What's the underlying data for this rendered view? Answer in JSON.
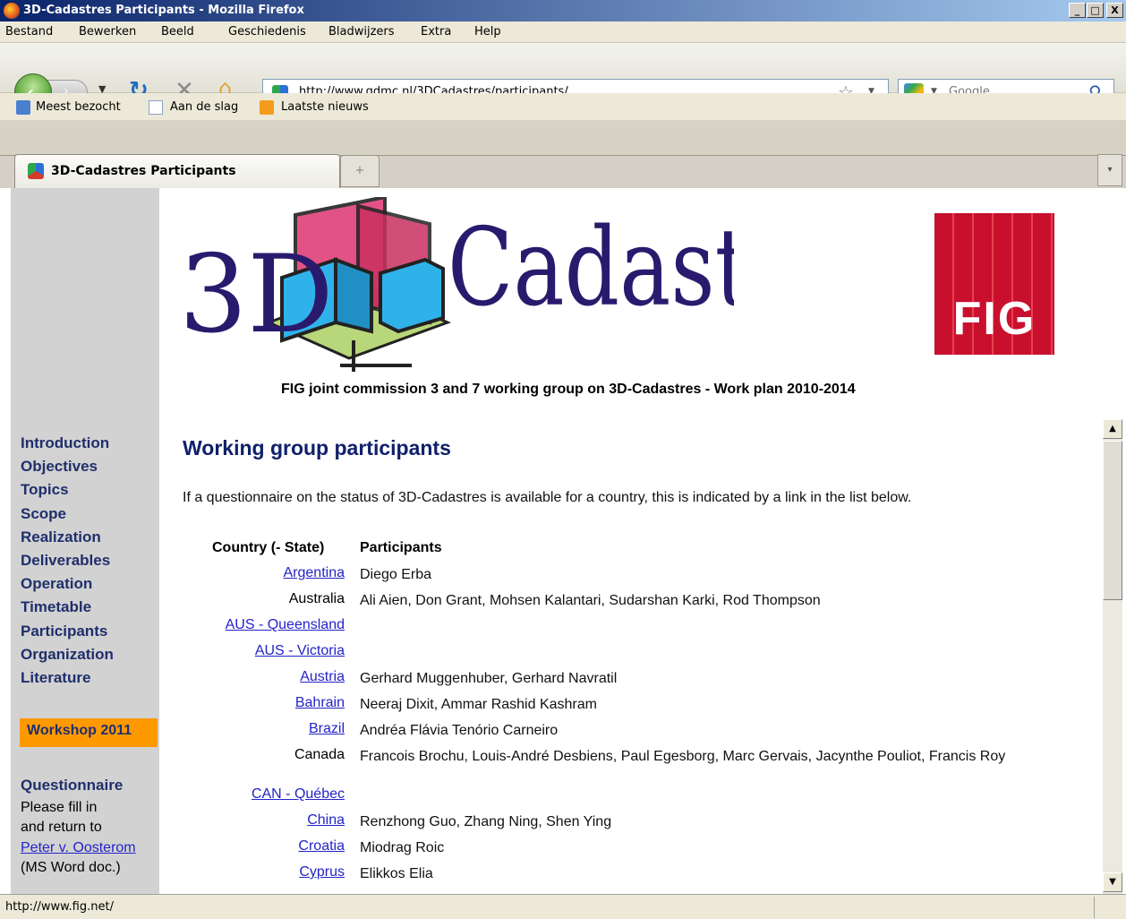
{
  "window": {
    "title": "3D-Cadastres Participants - Mozilla Firefox",
    "minimize": "_",
    "maximize": "□",
    "close": "X"
  },
  "menu": [
    "Bestand",
    "Bewerken",
    "Beeld",
    "Geschiedenis",
    "Bladwijzers",
    "Extra",
    "Help"
  ],
  "nav": {
    "url": "http://www.gdmc.nl/3DCadastres/participants/",
    "search_placeholder": "Google"
  },
  "bookmarks": [
    "Meest bezocht",
    "Aan de slag",
    "Laatste nieuws"
  ],
  "tab": {
    "label": "3D-Cadastres Participants",
    "new_tab": "+",
    "list": "▾"
  },
  "page": {
    "logo_text": "Cadastres",
    "logo_prefix": "3D",
    "fig_logo": "FIG",
    "subtitle": "FIG joint commission 3 and 7 working group on 3D-Cadastres - Work plan 2010-2014",
    "heading": "Working group participants",
    "intro": "If a questionnaire on the status of 3D-Cadastres is available for a country, this is indicated by a link in the list below.",
    "col_country": "Country (- State)",
    "col_participants": "Participants",
    "rows": [
      {
        "country": "Argentina",
        "link": true,
        "participants": "Diego Erba"
      },
      {
        "country": "Australia",
        "link": false,
        "participants": "Ali Aien, Don Grant, Mohsen Kalantari, Sudarshan Karki, Rod Thompson"
      },
      {
        "country": "AUS - Queensland",
        "link": true,
        "participants": ""
      },
      {
        "country": "AUS - Victoria",
        "link": true,
        "participants": ""
      },
      {
        "country": "Austria",
        "link": true,
        "participants": "Gerhard Muggenhuber, Gerhard Navratil"
      },
      {
        "country": "Bahrain",
        "link": true,
        "participants": "Neeraj Dixit, Ammar Rashid Kashram"
      },
      {
        "country": "Brazil",
        "link": true,
        "participants": "Andréa Flávia Tenório Carneiro"
      },
      {
        "country": "Canada",
        "link": false,
        "participants": "Francois Brochu, Louis-André Desbiens, Paul Egesborg, Marc Gervais, Jacynthe Pouliot, Francis Roy"
      },
      {
        "country": "CAN - Québec",
        "link": true,
        "participants": ""
      },
      {
        "country": "China",
        "link": true,
        "participants": "Renzhong Guo, Zhang Ning, Shen Ying"
      },
      {
        "country": "Croatia",
        "link": true,
        "participants": "Miodrag Roic"
      },
      {
        "country": "Cyprus",
        "link": true,
        "participants": "Elikkos Elia"
      }
    ]
  },
  "sidebar": {
    "links": [
      "Introduction",
      "Objectives",
      "Topics",
      "Scope",
      "Realization",
      "Deliverables",
      "Operation",
      "Timetable",
      "Participants",
      "Organization",
      "Literature"
    ],
    "workshop": "Workshop 2011",
    "questionnaire_title": "Questionnaire",
    "questionnaire_lines": [
      "Please fill in",
      "and return to"
    ],
    "contact_link": "Peter v. Oosterom",
    "doc_note": "(MS Word doc.)"
  },
  "status": {
    "text": "http://www.fig.net/"
  },
  "colors": {
    "nav_text": "#1f2f6b",
    "workshop_bg": "#ff9900",
    "fig_red": "#c8102e",
    "link": "#2323c8"
  }
}
